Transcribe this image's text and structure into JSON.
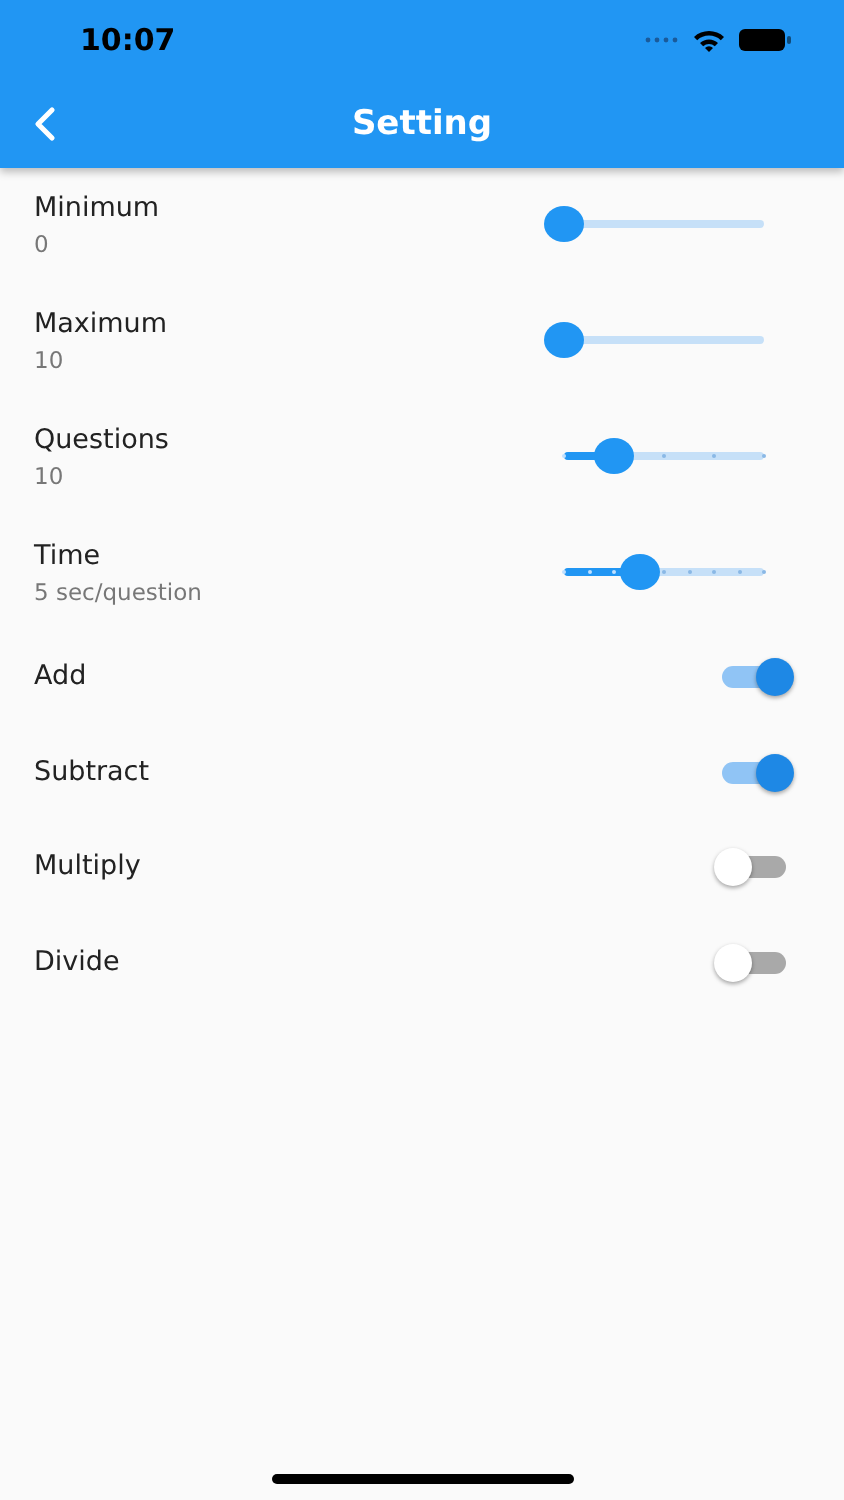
{
  "status_bar": {
    "time": "10:07"
  },
  "app_bar": {
    "title": "Setting"
  },
  "sliders": [
    {
      "label": "Minimum",
      "value": "0",
      "level": 0,
      "kind": "plain"
    },
    {
      "label": "Maximum",
      "value": "10",
      "level": 0,
      "kind": "plain"
    },
    {
      "label": "Questions",
      "value": "10",
      "level": 0.25,
      "kind": "steps4"
    },
    {
      "label": "Time",
      "value": "5 sec/question",
      "level": 0.375,
      "kind": "steps8"
    }
  ],
  "switches": [
    {
      "label": "Add",
      "on": true
    },
    {
      "label": "Subtract",
      "on": true
    },
    {
      "label": "Multiply",
      "on": false
    },
    {
      "label": "Divide",
      "on": false
    }
  ]
}
